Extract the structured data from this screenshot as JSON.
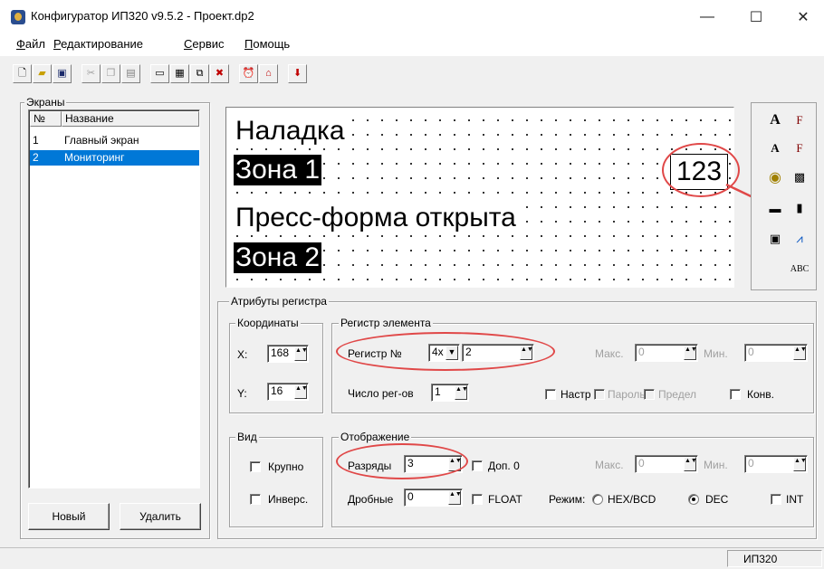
{
  "window": {
    "title": "Конфигуратор ИП320 v9.5.2 - Проект.dp2",
    "minimize": "—",
    "maximize": "☐",
    "close": "✕"
  },
  "menu": [
    {
      "first": "Ф",
      "rest": "айл"
    },
    {
      "first": "Р",
      "rest": "едактирование"
    },
    {
      "first": "С",
      "rest": "ервис"
    },
    {
      "first": "П",
      "rest": "омощь"
    }
  ],
  "screens": {
    "group_title": "Экраны",
    "col_num": "№",
    "col_name": "Название",
    "rows": [
      {
        "num": "1",
        "name": "Главный экран"
      },
      {
        "num": "2",
        "name": "Мониторинг"
      }
    ],
    "new_button": "Новый",
    "delete_button": "Удалить"
  },
  "canvas": {
    "line1": "Наладка",
    "line2": "Зона 1",
    "line3": "Пресс-форма открыта",
    "line4": "Зона 2",
    "numeric_value": "123"
  },
  "attrs": {
    "group_title": "Атрибуты регистра",
    "coords": {
      "title": "Координаты",
      "x_label": "X:",
      "x_value": "168",
      "y_label": "Y:",
      "y_value": "16"
    },
    "register": {
      "title": "Регистр элемента",
      "reg_label": "Регистр №",
      "reg_type": "4x",
      "reg_value": "2",
      "max_label": "Макс.",
      "max_value": "0",
      "min_label": "Мин.",
      "min_value": "0",
      "count_label": "Число рег-ов",
      "count_value": "1",
      "chk_setup": "Настр",
      "chk_password": "Пароль",
      "chk_limit": "Предел",
      "chk_conv": "Конв."
    },
    "view": {
      "title": "Вид",
      "large": "Крупно",
      "invert": "Инверс."
    },
    "display": {
      "title": "Отображение",
      "digits_label": "Разряды",
      "digits_value": "3",
      "extra_zero": "Доп. 0",
      "max_label": "Макс.",
      "max_value": "0",
      "min_label": "Мин.",
      "min_value": "0",
      "fraction_label": "Дробные",
      "fraction_value": "0",
      "float": "FLOAT",
      "mode_label": "Режим:",
      "mode_hex": "HEX/BCD",
      "mode_dec": "DEC",
      "mode_selected": "DEC",
      "int": "INT"
    }
  },
  "status": {
    "device": "ИП320"
  },
  "colors": {
    "highlight": "#e04848",
    "selection": "#0078d7"
  }
}
